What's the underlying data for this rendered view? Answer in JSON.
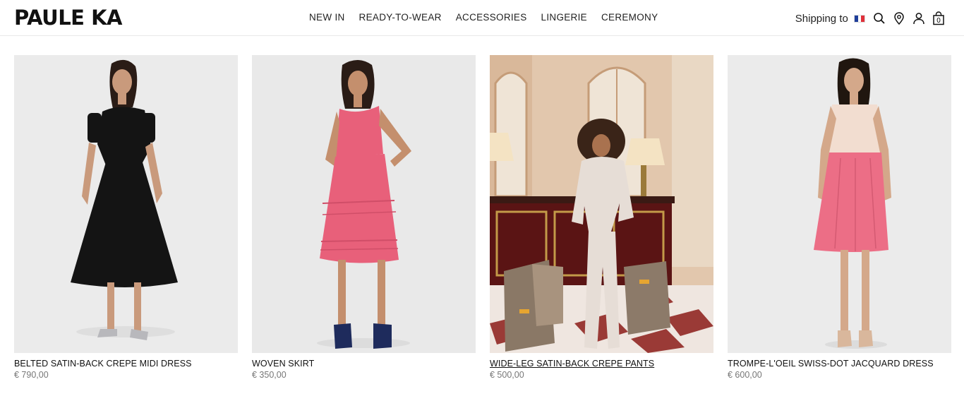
{
  "brand": {
    "name": "PAULE KA"
  },
  "nav": {
    "items": [
      {
        "label": "NEW IN"
      },
      {
        "label": "READY-TO-WEAR"
      },
      {
        "label": "ACCESSORIES"
      },
      {
        "label": "LINGERIE"
      },
      {
        "label": "CEREMONY"
      }
    ]
  },
  "tools": {
    "shipping_label": "Shipping to",
    "flag_colors": [
      "#1f3e9a",
      "#ffffff",
      "#e0303a"
    ],
    "cart_count": "0",
    "icons": [
      "search-icon",
      "location-pin-icon",
      "user-icon",
      "bag-icon"
    ]
  },
  "products": [
    {
      "name": "BELTED SATIN-BACK CREPE MIDI DRESS",
      "price": "€ 790,00",
      "garment_color": "#141414"
    },
    {
      "name": "WOVEN SKIRT",
      "price": "€ 350,00",
      "garment_color": "#e8607a"
    },
    {
      "name": "WIDE-LEG SATIN-BACK CREPE PANTS",
      "price": "€ 500,00",
      "garment_color": "#e6ddd6"
    },
    {
      "name": "TROMPE-L'OEIL SWISS-DOT JACQUARD DRESS",
      "price": "€ 600,00",
      "garment_color": "#ec6e86"
    }
  ]
}
